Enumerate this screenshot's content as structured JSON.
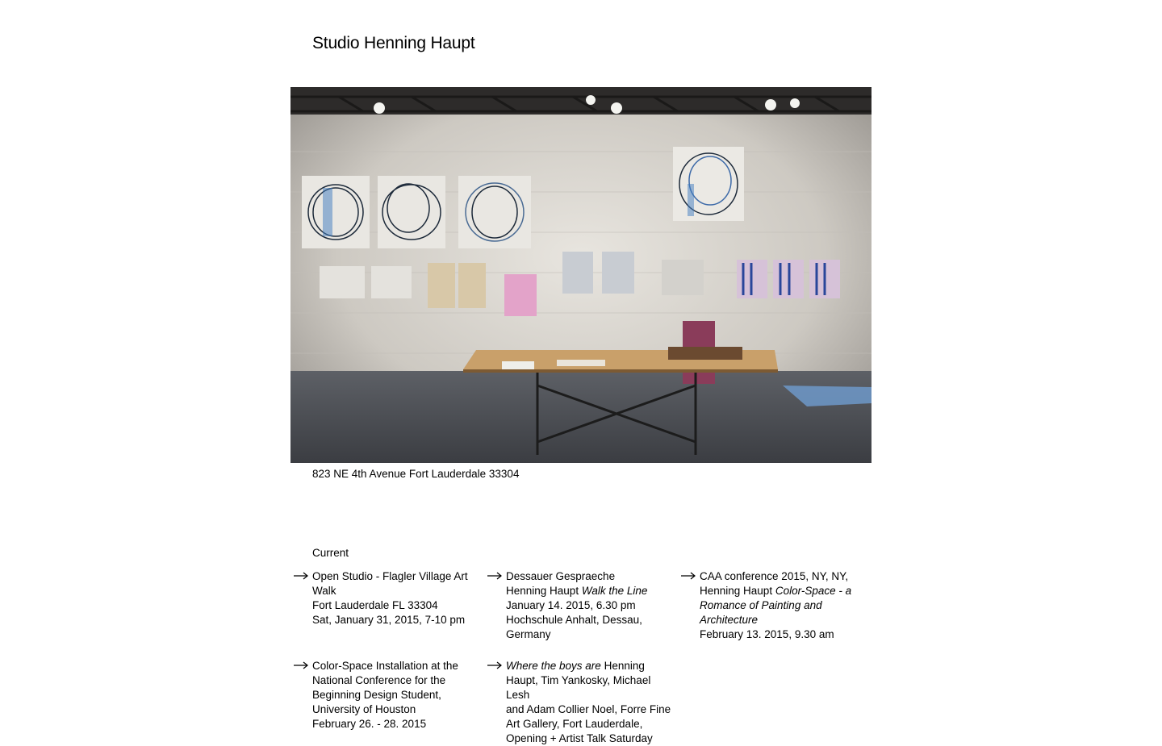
{
  "site": {
    "title": "Studio Henning Haupt"
  },
  "hero": {
    "alt": "Studio installation view with drawings on a white brick wall and a worktable"
  },
  "address": "823 NE 4th Avenue Fort Lauderdale 33304",
  "current": {
    "heading": "Current",
    "arrow_icon": "right-arrow-icon",
    "events": [
      {
        "lines": [
          "Open Studio - Flagler Village Art",
          "Walk",
          "Fort Lauderdale FL 33304",
          "Sat, January 31, 2015, 7-10 pm"
        ]
      },
      {
        "lines": [
          "Dessauer Gespraeche",
          "Henning Haupt",
          "Walk the Line",
          "January 14. 2015, 6.30 pm",
          "Hochschule Anhalt, Dessau,",
          "Germany"
        ]
      },
      {
        "lines": [
          "CAA conference 2015, NY, NY,",
          "Henning Haupt",
          "Color-Space - a",
          "Romance of Painting and",
          "Architecture",
          "February 13. 2015, 9.30 am"
        ]
      },
      {
        "lines": [
          "Color-Space Installation at the",
          "National Conference for the",
          "Beginning Design Student,",
          "University of Houston",
          "February 26. - 28. 2015"
        ]
      },
      {
        "lines": [
          "Where the boys are",
          "Henning",
          "Haupt, Tim Yankosky, Michael Lesh",
          "and Adam Collier Noel, Forre Fine",
          "Art Gallery, Fort Lauderdale,",
          "Opening + Artist Talk Saturday"
        ]
      }
    ]
  }
}
